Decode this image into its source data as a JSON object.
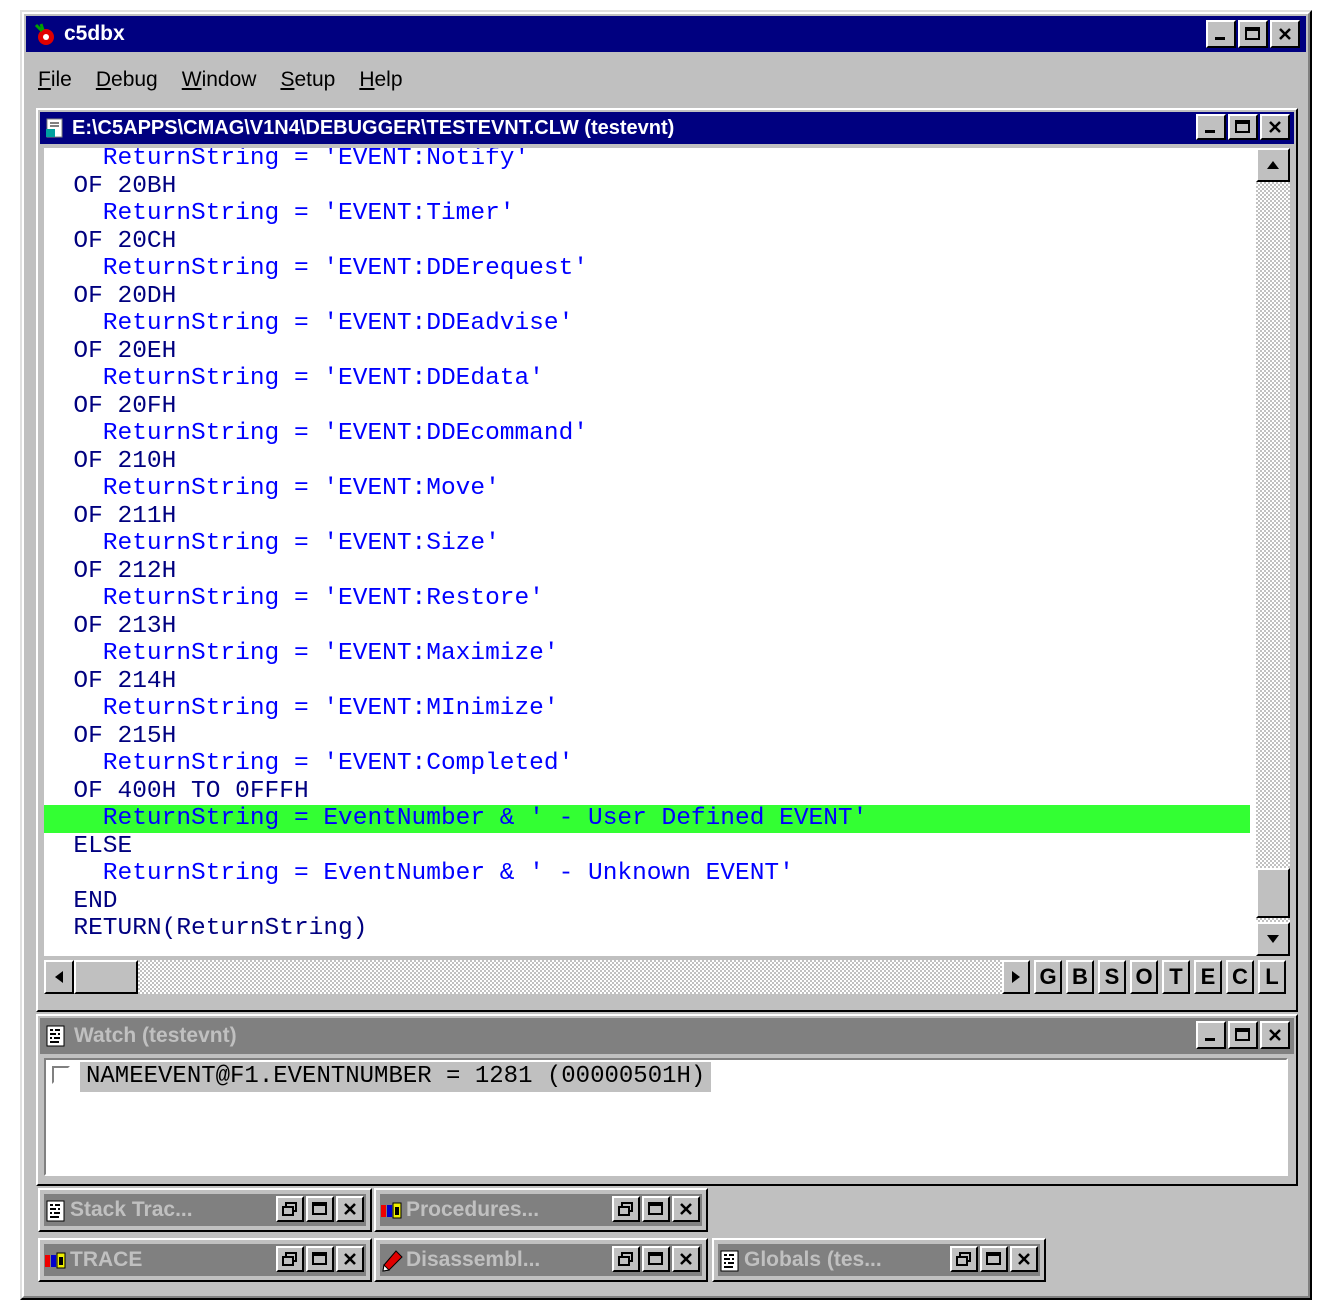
{
  "app": {
    "title": "c5dbx",
    "controls": [
      "_",
      "□",
      "×"
    ]
  },
  "menu": [
    {
      "accel": "F",
      "rest": "ile"
    },
    {
      "accel": "D",
      "rest": "ebug"
    },
    {
      "accel": "W",
      "rest": "indow"
    },
    {
      "accel": "S",
      "rest": "etup"
    },
    {
      "accel": "H",
      "rest": "elp"
    }
  ],
  "source": {
    "title": "E:\\C5APPS\\CMAG\\V1N4\\DEBUGGER\\TESTEVNT.CLW (testevnt)",
    "lines": [
      "    ReturnString = 'EVENT:Notify'",
      "  OF 20BH",
      "    ReturnString = 'EVENT:Timer'",
      "  OF 20CH",
      "    ReturnString = 'EVENT:DDErequest'",
      "  OF 20DH",
      "    ReturnString = 'EVENT:DDEadvise'",
      "  OF 20EH",
      "    ReturnString = 'EVENT:DDEdata'",
      "  OF 20FH",
      "    ReturnString = 'EVENT:DDEcommand'",
      "  OF 210H",
      "    ReturnString = 'EVENT:Move'",
      "  OF 211H",
      "    ReturnString = 'EVENT:Size'",
      "  OF 212H",
      "    ReturnString = 'EVENT:Restore'",
      "  OF 213H",
      "    ReturnString = 'EVENT:Maximize'",
      "  OF 214H",
      "    ReturnString = 'EVENT:MInimize'",
      "  OF 215H",
      "    ReturnString = 'EVENT:Completed'",
      "  OF 400H TO 0FFFH",
      "    ReturnString = EventNumber & ' - User Defined EVENT'",
      "  ELSE",
      "    ReturnString = EventNumber & ' - Unknown EVENT'",
      "  END",
      "  RETURN(ReturnString)"
    ],
    "highlight_line_index": 24,
    "toolbar_letters": [
      "G",
      "B",
      "S",
      "O",
      "T",
      "E",
      "C",
      "L"
    ]
  },
  "watch": {
    "title": "Watch (testevnt)",
    "entry": "NAMEEVENT@F1.EVENTNUMBER = 1281 (00000501H)"
  },
  "minimized": [
    {
      "title": "Stack Trac...",
      "icon": "doc-icon"
    },
    {
      "title": "Procedures...",
      "icon": "blocks-icon"
    },
    {
      "title": "TRACE",
      "icon": "blocks-icon"
    },
    {
      "title": "Disassembl...",
      "icon": "pencil-icon"
    },
    {
      "title": "Globals (tes...",
      "icon": "doc-icon"
    }
  ],
  "colors": {
    "active_title": "#000080",
    "inactive_title": "#808080",
    "code_text": "#0000ff",
    "highlight": "#33ff33"
  }
}
